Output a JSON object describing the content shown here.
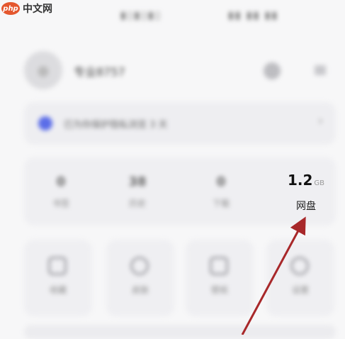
{
  "watermark": {
    "logo": "php",
    "text": "中文网"
  },
  "profile": {
    "username": "专业8757"
  },
  "notice": {
    "text": "已为你保护隐私浏览 3 天"
  },
  "stats": {
    "items": [
      {
        "value": "0",
        "label": "书签"
      },
      {
        "value": "38",
        "label": "历史"
      },
      {
        "value": "0",
        "label": "下载"
      }
    ],
    "cloud": {
      "value": "1.2",
      "unit": "GB",
      "label": "网盘"
    }
  },
  "tiles": [
    {
      "label": "收藏"
    },
    {
      "label": "皮肤"
    },
    {
      "label": "壁纸"
    },
    {
      "label": "设置"
    }
  ],
  "colors": {
    "arrow": "#a8282a",
    "accent": "#5b6de8"
  }
}
